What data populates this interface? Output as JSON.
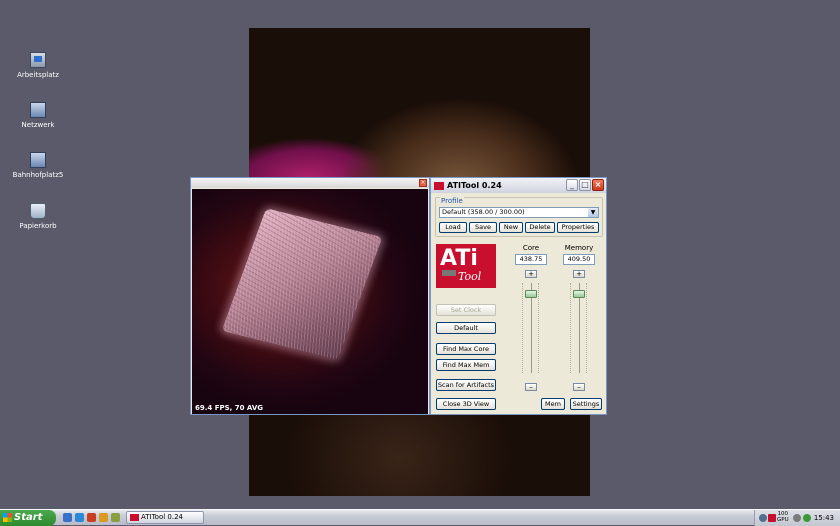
{
  "desktop": {
    "icons": [
      {
        "label": "Arbeitsplatz",
        "icon": "my-computer-icon"
      },
      {
        "label": "Netzwerk",
        "icon": "network-icon"
      },
      {
        "label": "Bahnhofplatz5",
        "icon": "network-place-icon"
      },
      {
        "label": "Papierkorb",
        "icon": "recycle-bin-icon"
      }
    ]
  },
  "render_window": {
    "fps_text": "69.4 FPS, 70 AVG"
  },
  "atitool": {
    "title": "ATITool 0.24",
    "profile": {
      "label": "Profile",
      "selected": "Default (358.00 / 300.00)",
      "buttons": {
        "load": "Load",
        "save": "Save",
        "new": "New",
        "delete": "Delete",
        "properties": "Properties"
      }
    },
    "logo": {
      "ati": "ATi",
      "tool": "Tool"
    },
    "core": {
      "label": "Core",
      "value": "438.75",
      "plus": "+",
      "minus": "–",
      "slider_level": 0.08
    },
    "memory": {
      "label": "Memory",
      "value": "409.50",
      "plus": "+",
      "minus": "–",
      "slider_level": 0.08
    },
    "buttons": {
      "set_clock": "Set Clock",
      "default": "Default",
      "find_max_core": "Find Max Core",
      "find_max_mem": "Find Max Mem",
      "scan_artifacts": "Scan for Artifacts",
      "close_3d_view": "Close 3D View",
      "mem": "Mem",
      "settings": "Settings"
    }
  },
  "taskbar": {
    "start_label": "Start",
    "task_label": "ATITool 0.24",
    "tray_temp_top": "100",
    "tray_temp_bottom": "GPU",
    "clock": "15:43"
  },
  "colors": {
    "desktop_bg": "#5a5a6a",
    "ati_red": "#c8102e",
    "start_green": "#3a9a3a"
  }
}
